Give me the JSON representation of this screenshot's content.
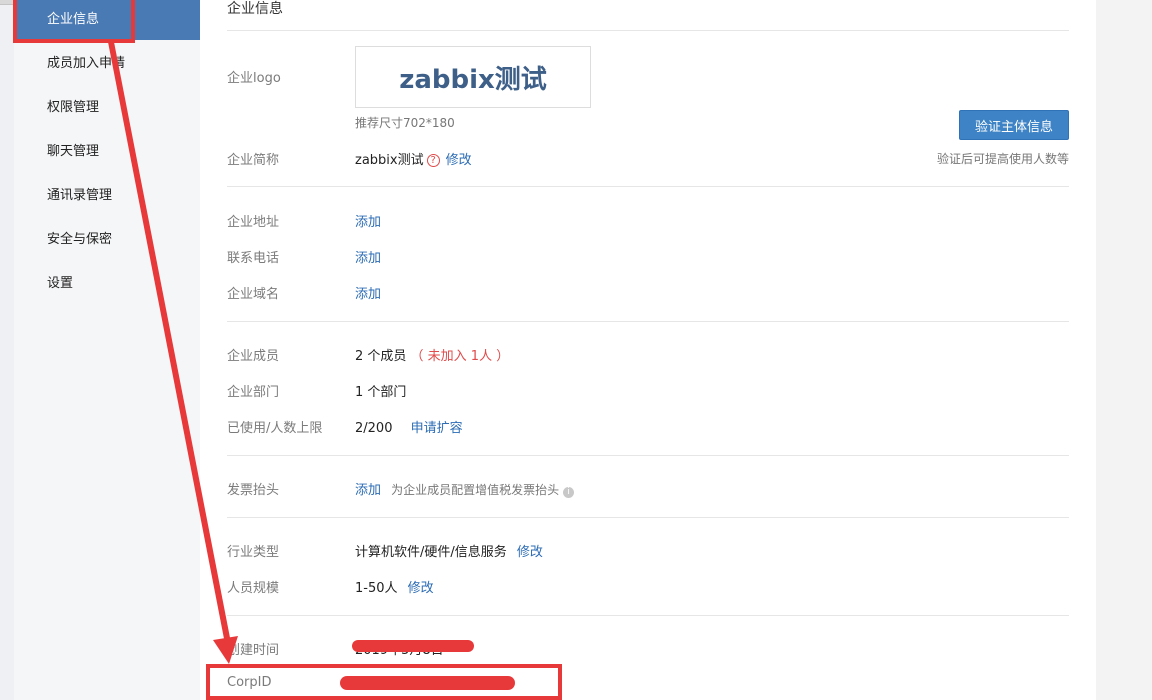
{
  "sidebar": {
    "items": [
      {
        "label": "企业信息",
        "active": true
      },
      {
        "label": "成员加入申请"
      },
      {
        "label": "权限管理"
      },
      {
        "label": "聊天管理"
      },
      {
        "label": "通讯录管理"
      },
      {
        "label": "安全与保密"
      },
      {
        "label": "设置"
      }
    ]
  },
  "main": {
    "title": "企业信息",
    "logo": {
      "label": "企业logo",
      "text": "zabbix测试",
      "hint": "推荐尺寸702*180"
    },
    "verify_button": "验证主体信息",
    "verify_hint": "验证后可提高使用人数等",
    "short_name": {
      "label": "企业简称",
      "value": "zabbix测试",
      "edit": "修改"
    },
    "address": {
      "label": "企业地址",
      "action": "添加"
    },
    "phone": {
      "label": "联系电话",
      "action": "添加"
    },
    "domain": {
      "label": "企业域名",
      "action": "添加"
    },
    "members": {
      "label": "企业成员",
      "value": "2 个成员",
      "note": "（ 未加入 1人 ）"
    },
    "departments": {
      "label": "企业部门",
      "value": "1 个部门"
    },
    "usage": {
      "label": "已使用/人数上限",
      "value": "2/200",
      "action": "申请扩容"
    },
    "invoice": {
      "label": "发票抬头",
      "action": "添加",
      "hint": "为企业成员配置增值税发票抬头"
    },
    "industry": {
      "label": "行业类型",
      "value": "计算机软件/硬件/信息服务",
      "edit": "修改"
    },
    "scale": {
      "label": "人员规模",
      "value": "1-50人",
      "edit": "修改"
    },
    "created": {
      "label": "创建时间",
      "value": "2019年5月8日"
    },
    "corpid": {
      "label": "CorpID"
    }
  },
  "colors": {
    "sidebar_active": "#4a7ab4",
    "link": "#2c6cb5",
    "annotation_red": "#e8393a",
    "button": "#3d83c6"
  }
}
